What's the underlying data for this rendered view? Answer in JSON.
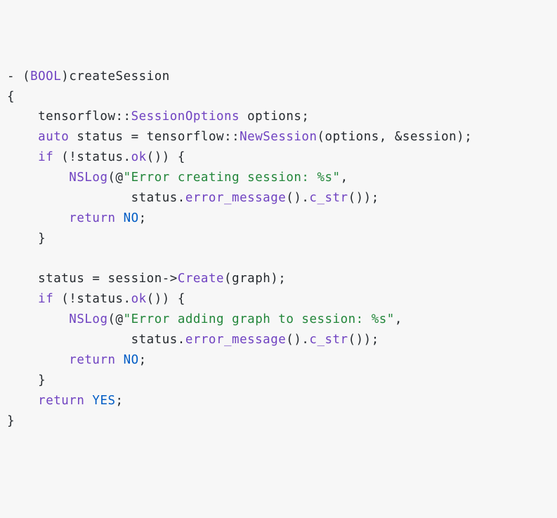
{
  "code": {
    "tokens": [
      [
        {
          "t": "- (",
          "c": "op"
        },
        {
          "t": "BOOL",
          "c": "kw"
        },
        {
          "t": ")",
          "c": "op"
        },
        {
          "t": "createSession",
          "c": "ident"
        }
      ],
      [
        {
          "t": "{",
          "c": "op"
        }
      ],
      [
        {
          "t": "    tensorflow",
          "c": "ident"
        },
        {
          "t": "::",
          "c": "op"
        },
        {
          "t": "SessionOptions",
          "c": "kw"
        },
        {
          "t": " options;",
          "c": "op"
        }
      ],
      [
        {
          "t": "    ",
          "c": "op"
        },
        {
          "t": "auto",
          "c": "kw"
        },
        {
          "t": " status ",
          "c": "ident"
        },
        {
          "t": "=",
          "c": "op"
        },
        {
          "t": " tensorflow",
          "c": "ident"
        },
        {
          "t": "::",
          "c": "op"
        },
        {
          "t": "NewSession",
          "c": "call"
        },
        {
          "t": "(options, ",
          "c": "ident"
        },
        {
          "t": "&",
          "c": "op"
        },
        {
          "t": "session);",
          "c": "ident"
        }
      ],
      [
        {
          "t": "    ",
          "c": "op"
        },
        {
          "t": "if",
          "c": "kw"
        },
        {
          "t": " (!status.",
          "c": "ident"
        },
        {
          "t": "ok",
          "c": "call"
        },
        {
          "t": "()) {",
          "c": "op"
        }
      ],
      [
        {
          "t": "        ",
          "c": "op"
        },
        {
          "t": "NSLog",
          "c": "call"
        },
        {
          "t": "(",
          "c": "op"
        },
        {
          "t": "@",
          "c": "at"
        },
        {
          "t": "\"Error creating session: %s\"",
          "c": "str"
        },
        {
          "t": ",",
          "c": "op"
        }
      ],
      [
        {
          "t": "                status.",
          "c": "ident"
        },
        {
          "t": "error_message",
          "c": "call"
        },
        {
          "t": "().",
          "c": "op"
        },
        {
          "t": "c_str",
          "c": "call"
        },
        {
          "t": "());",
          "c": "op"
        }
      ],
      [
        {
          "t": "        ",
          "c": "op"
        },
        {
          "t": "return",
          "c": "kw"
        },
        {
          "t": " ",
          "c": "op"
        },
        {
          "t": "NO",
          "c": "const"
        },
        {
          "t": ";",
          "c": "op"
        }
      ],
      [
        {
          "t": "    }",
          "c": "op"
        }
      ],
      [
        {
          "t": " ",
          "c": "op"
        }
      ],
      [
        {
          "t": "    status ",
          "c": "ident"
        },
        {
          "t": "=",
          "c": "op"
        },
        {
          "t": " session",
          "c": "ident"
        },
        {
          "t": "->",
          "c": "op"
        },
        {
          "t": "Create",
          "c": "call"
        },
        {
          "t": "(graph);",
          "c": "ident"
        }
      ],
      [
        {
          "t": "    ",
          "c": "op"
        },
        {
          "t": "if",
          "c": "kw"
        },
        {
          "t": " (!status.",
          "c": "ident"
        },
        {
          "t": "ok",
          "c": "call"
        },
        {
          "t": "()) {",
          "c": "op"
        }
      ],
      [
        {
          "t": "        ",
          "c": "op"
        },
        {
          "t": "NSLog",
          "c": "call"
        },
        {
          "t": "(",
          "c": "op"
        },
        {
          "t": "@",
          "c": "at"
        },
        {
          "t": "\"Error adding graph to session: %s\"",
          "c": "str"
        },
        {
          "t": ",",
          "c": "op"
        }
      ],
      [
        {
          "t": "                status.",
          "c": "ident"
        },
        {
          "t": "error_message",
          "c": "call"
        },
        {
          "t": "().",
          "c": "op"
        },
        {
          "t": "c_str",
          "c": "call"
        },
        {
          "t": "());",
          "c": "op"
        }
      ],
      [
        {
          "t": "        ",
          "c": "op"
        },
        {
          "t": "return",
          "c": "kw"
        },
        {
          "t": " ",
          "c": "op"
        },
        {
          "t": "NO",
          "c": "const"
        },
        {
          "t": ";",
          "c": "op"
        }
      ],
      [
        {
          "t": "    }",
          "c": "op"
        }
      ],
      [
        {
          "t": "    ",
          "c": "op"
        },
        {
          "t": "return",
          "c": "kw"
        },
        {
          "t": " ",
          "c": "op"
        },
        {
          "t": "YES",
          "c": "const"
        },
        {
          "t": ";",
          "c": "op"
        }
      ],
      [
        {
          "t": "}",
          "c": "op"
        }
      ]
    ]
  }
}
